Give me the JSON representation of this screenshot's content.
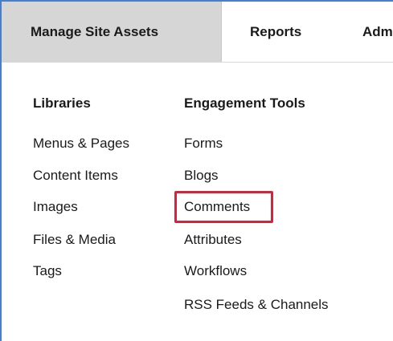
{
  "tabs": {
    "manage_site_assets": "Manage Site Assets",
    "reports": "Reports",
    "admin": "Adm"
  },
  "libraries": {
    "heading": "Libraries",
    "items": [
      "Menus & Pages",
      "Content Items",
      "Images",
      "Files & Media",
      "Tags"
    ]
  },
  "engagement_tools": {
    "heading": "Engagement Tools",
    "items": [
      "Forms",
      "Blogs",
      "Comments",
      "Attributes",
      "Workflows",
      "RSS Feeds & Channels"
    ],
    "highlighted_item": "Comments"
  },
  "colors": {
    "frame_border": "#4a7fc7",
    "active_tab_bg": "#d6d6d6",
    "highlight_border": "#d0253a",
    "text": "#1a1a1a"
  }
}
